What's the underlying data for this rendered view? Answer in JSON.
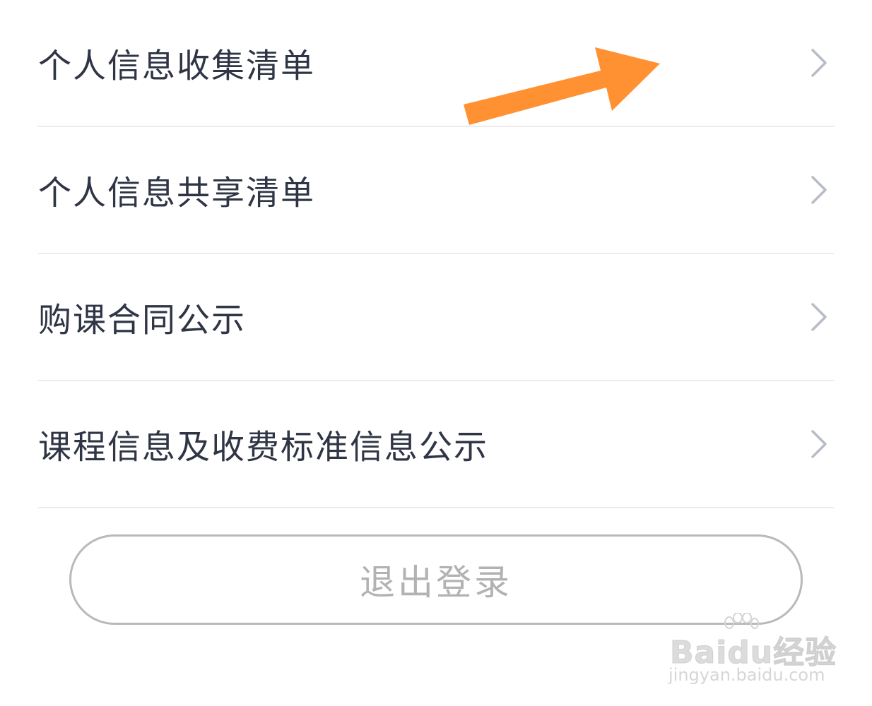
{
  "menu": {
    "items": [
      {
        "label": "个人信息收集清单"
      },
      {
        "label": "个人信息共享清单"
      },
      {
        "label": "购课合同公示"
      },
      {
        "label": "课程信息及收费标准信息公示"
      }
    ]
  },
  "logout": {
    "label": "退出登录"
  },
  "watermark": {
    "brand": "Baidu经验",
    "domain": "jingyan.baidu.com"
  },
  "colors": {
    "text": "#2f3545",
    "divider": "#ececec",
    "chevron": "#b7bcc6",
    "button_border": "#b9b9b9",
    "button_text": "#b2b2b2",
    "annotation_arrow": "#ff9133"
  },
  "icons": {
    "chevron": "chevron-right-icon",
    "arrow": "annotation-arrow-icon",
    "paw": "baidu-paw-icon"
  }
}
